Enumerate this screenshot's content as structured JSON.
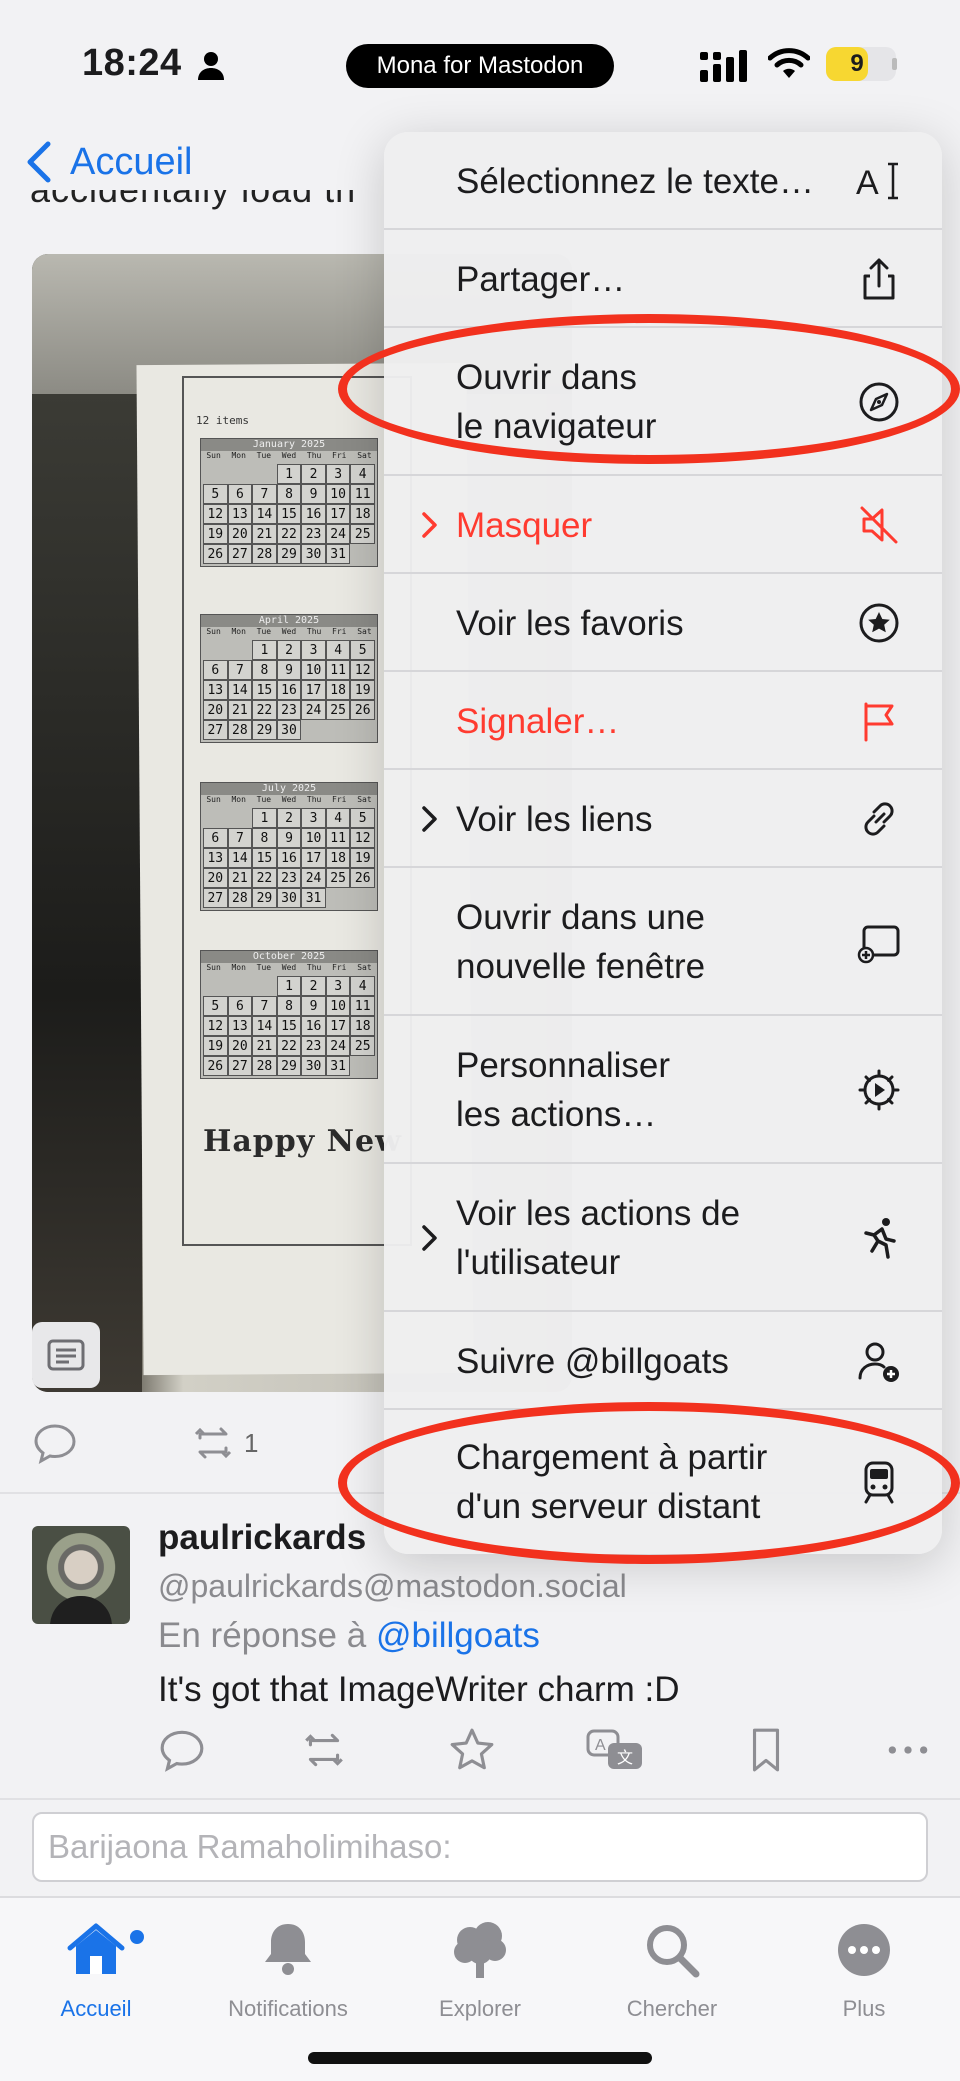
{
  "status_bar": {
    "time": "18:24",
    "app_name": "Mona for Mastodon",
    "battery": "9",
    "battery_level": 0.09
  },
  "nav": {
    "back_label": "Accueil"
  },
  "post": {
    "partial_text": "accidentally load th"
  },
  "photo": {
    "items_label": "12 items",
    "calendars": [
      {
        "month": "January 2025",
        "days": [
          "Sun",
          "Mon",
          "Tue",
          "Wed",
          "Thu",
          "Fri",
          "Sat"
        ]
      },
      {
        "month": "April 2025",
        "days": [
          "Sun",
          "Mon",
          "Tue",
          "Wed",
          "Thu",
          "Fri",
          "Sat"
        ]
      },
      {
        "month": "July 2025",
        "days": [
          "Sun",
          "Mon",
          "Tue",
          "Wed",
          "Thu",
          "Fri",
          "Sat"
        ]
      },
      {
        "month": "October 2025",
        "days": [
          "Sun",
          "Mon",
          "Tue",
          "Wed",
          "Thu",
          "Fri",
          "Sat"
        ]
      }
    ],
    "greeting": "Happy New"
  },
  "post_actions": {
    "boost_count": "1"
  },
  "reply": {
    "name": "paulrickards",
    "handle": "@paulrickards@mastodon.social",
    "in_reply_prefix": "En réponse à",
    "in_reply_mention": "@billgoats",
    "text": "It's got that ImageWriter charm :D"
  },
  "compose": {
    "placeholder": "Barijaona Ramaholimihaso:"
  },
  "menu": {
    "items": [
      {
        "label_1": "Sélectionnez le texte…",
        "label_2": "",
        "icon": "text-cursor-icon",
        "red": false,
        "chevron": false
      },
      {
        "label_1": "Partager…",
        "label_2": "",
        "icon": "share-icon",
        "red": false,
        "chevron": false
      },
      {
        "label_1": "Ouvrir dans",
        "label_2": "le navigateur",
        "icon": "compass-icon",
        "red": false,
        "chevron": false
      },
      {
        "label_1": "Masquer",
        "label_2": "",
        "icon": "speaker-mute-icon",
        "red": true,
        "chevron": true
      },
      {
        "label_1": "Voir les favoris",
        "label_2": "",
        "icon": "star-circle-icon",
        "red": false,
        "chevron": false
      },
      {
        "label_1": "Signaler…",
        "label_2": "",
        "icon": "flag-icon",
        "red": true,
        "chevron": false
      },
      {
        "label_1": "Voir les liens",
        "label_2": "",
        "icon": "link-icon",
        "red": false,
        "chevron": true
      },
      {
        "label_1": "Ouvrir dans une",
        "label_2": "nouvelle fenêtre",
        "icon": "new-window-icon",
        "red": false,
        "chevron": false
      },
      {
        "label_1": "Personnaliser",
        "label_2": "les actions…",
        "icon": "gear-play-icon",
        "red": false,
        "chevron": false
      },
      {
        "label_1": "Voir les actions de",
        "label_2": "l'utilisateur",
        "icon": "running-figure-icon",
        "red": false,
        "chevron": true
      },
      {
        "label_1": "Suivre @billgoats",
        "label_2": "",
        "icon": "person-add-icon",
        "red": false,
        "chevron": false
      },
      {
        "label_1": "Chargement à partir",
        "label_2": "d'un serveur distant",
        "icon": "tram-icon",
        "red": false,
        "chevron": false
      }
    ]
  },
  "tabs": [
    {
      "label": "Accueil",
      "icon": "house-icon",
      "active": true
    },
    {
      "label": "Notifications",
      "icon": "bell-icon",
      "active": false
    },
    {
      "label": "Explorer",
      "icon": "tree-icon",
      "active": false
    },
    {
      "label": "Chercher",
      "icon": "magnifier-icon",
      "active": false
    },
    {
      "label": "Plus",
      "icon": "ellipsis-circle-icon",
      "active": false
    }
  ],
  "colors": {
    "accent": "#1a73e8",
    "destructive": "#ff3b30",
    "annotation": "#f2311e"
  }
}
